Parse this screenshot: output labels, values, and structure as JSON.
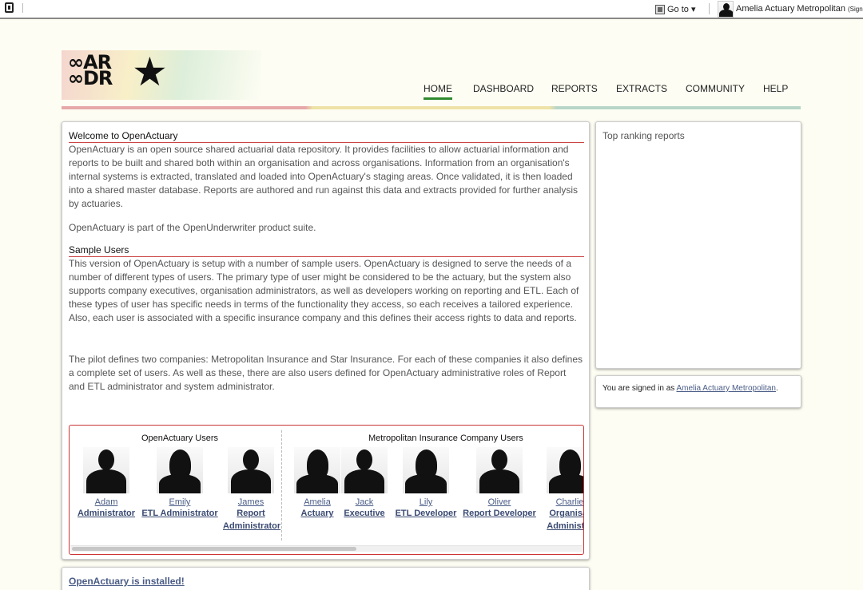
{
  "topbar": {
    "goto_label": "Go to ▾",
    "user_name": "Amelia Actuary Metropolitan",
    "sign_out": "(Sign Out)"
  },
  "logo": {
    "line1": "AR",
    "line2": "DR"
  },
  "nav": {
    "items": [
      {
        "label": "HOME"
      },
      {
        "label": "DASHBOARD"
      },
      {
        "label": "REPORTS"
      },
      {
        "label": "EXTRACTS"
      },
      {
        "label": "COMMUNITY"
      },
      {
        "label": "HELP"
      }
    ],
    "active": "HOME",
    "active_color": "#2f8a2f"
  },
  "main": {
    "welcome_heading": "Welcome to OpenActuary",
    "welcome_text": "OpenActuary is an open source shared actuarial data repository. It provides facilities to allow actuarial information and reports to be built and shared both within an organisation and across organisations. Information from an organisation's internal systems is extracted, translated and loaded into OpenActuary's staging areas. Once validated, it is then loaded into a shared master database. Reports are authored and run against this data and extracts provided for further analysis by actuaries.",
    "suite_text": "OpenActuary is part of the OpenUnderwriter product suite.",
    "sample_heading": "Sample Users",
    "sample_text": "This version of OpenActuary is setup with a number of sample users. OpenActuary is designed to serve the needs of a number of different types of users. The primary type of user might be considered to be the actuary, but the system also supports company executives, organisation administrators, as well as developers working on reporting and ETL. Each of these types of user has specific needs in terms of the functionality they access, so each receives a tailored experience. Also, each user is associated with a specific insurance company and this defines their access rights to data and reports.",
    "pilot_text": "The pilot defines two companies: Metropolitan Insurance and Star Insurance. For each of these companies it also defines a complete set of users. As well as these, there are also users defined for OpenActuary administrative roles of Report and ETL administrator and system administrator."
  },
  "users_box": {
    "group1_title": "OpenActuary Users",
    "group2_title": "Metropolitan Insurance Company Users",
    "users": [
      {
        "name": "Adam",
        "role1": "Administrator",
        "role2": "",
        "gender": "male"
      },
      {
        "name": "Emily",
        "role1": "ETL Administrator",
        "role2": "",
        "gender": "female"
      },
      {
        "name": "James",
        "role1": "Report",
        "role2": "Administrator",
        "gender": "male"
      },
      {
        "name": "Amelia",
        "role1": "Actuary",
        "role2": "",
        "gender": "female"
      },
      {
        "name": "Jack",
        "role1": "Executive",
        "role2": "",
        "gender": "male"
      },
      {
        "name": "Lily",
        "role1": "ETL Developer",
        "role2": "",
        "gender": "female"
      },
      {
        "name": "Oliver",
        "role1": "Report Developer",
        "role2": "",
        "gender": "male"
      },
      {
        "name": "Charlie",
        "role1": "Organisat",
        "role2": "Administra",
        "gender": "female"
      }
    ],
    "scroll_fraction": 0.55
  },
  "ranking": {
    "title": "Top ranking reports"
  },
  "signed_in": {
    "prefix": "You are signed in as ",
    "user": "Amelia Actuary Metropolitan",
    "suffix": "."
  },
  "bottom": {
    "installed_label": "OpenActuary is installed!"
  },
  "colors": {
    "background": "#fdfdf3",
    "link": "#4a5c86",
    "heading_rule": "#cc4444",
    "users_border": "#cc3333"
  }
}
